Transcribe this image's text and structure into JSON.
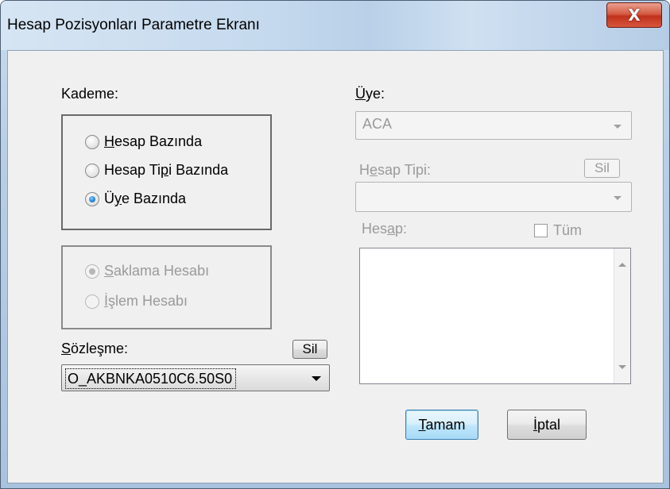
{
  "window": {
    "title": "Hesap Pozisyonları Parametre Ekranı",
    "close_label": "X"
  },
  "kademe": {
    "label": "Kademe:",
    "options": [
      {
        "pre": "",
        "acc": "H",
        "post": "esap Bazında",
        "checked": false
      },
      {
        "pre": "Hesap Ti",
        "acc": "p",
        "post": "i Bazında",
        "checked": false
      },
      {
        "pre": "Ü",
        "acc": "y",
        "post": "e Bazında",
        "checked": true
      }
    ]
  },
  "hesap_turu": {
    "options": [
      {
        "pre": "",
        "acc": "S",
        "post": "aklama Hesabı",
        "checked": true
      },
      {
        "pre": "",
        "acc": "İ",
        "post": "şlem Hesabı",
        "checked": false
      }
    ]
  },
  "sozlesme": {
    "label_pre": "",
    "label_acc": "S",
    "label_post": "özleşme:",
    "sil_label": "Sil",
    "value": "O_AKBNKA0510C6.50S0"
  },
  "uye": {
    "label_pre": "",
    "label_acc": "Ü",
    "label_post": "ye:",
    "value": "ACA"
  },
  "hesap_tipi": {
    "label_pre": "H",
    "label_acc": "e",
    "label_post": "sap Tipi:",
    "sil_label": "Sil",
    "value": ""
  },
  "hesap": {
    "label_pre": "Hes",
    "label_acc": "a",
    "label_post": "p:",
    "tum_label": "Tüm",
    "tum_checked": false,
    "items": []
  },
  "buttons": {
    "ok_acc": "T",
    "ok_post": "amam",
    "cancel_acc": "İ",
    "cancel_post": "ptal"
  }
}
